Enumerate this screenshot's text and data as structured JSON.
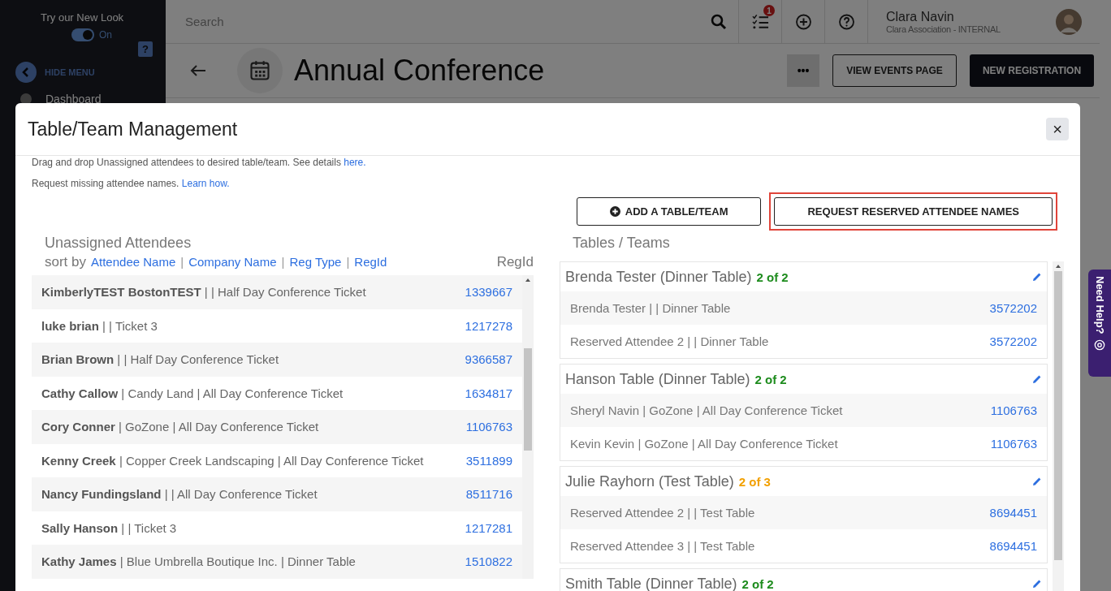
{
  "sidebar": {
    "new_look_label": "Try our New Look",
    "toggle": {
      "on": true,
      "label": "On"
    },
    "help_badge": "?",
    "hide_menu": "HIDE MENU",
    "items": [
      "Dashboard"
    ]
  },
  "top_bar": {
    "search": {
      "placeholder": "Search"
    },
    "tasks_badge": "1",
    "user": {
      "name": "Clara Navin",
      "org": "Clara Association - INTERNAL"
    }
  },
  "page_header": {
    "title": "Annual Conference",
    "more_button": "•••",
    "buttons": [
      "VIEW EVENTS PAGE",
      "NEW REGISTRATION"
    ]
  },
  "modal": {
    "title": "Table/Team Management",
    "close": "×",
    "info": [
      {
        "text": "Drag and drop Unassigned attendees to desired table/team. See details ",
        "link": "here."
      },
      {
        "text": "Request missing attendee names. ",
        "link": "Learn how."
      }
    ],
    "buttons": [
      {
        "label": "ADD A TABLE/TEAM",
        "kind": "add",
        "highlighted": false
      },
      {
        "label": "REQUEST RESERVED ATTENDEE NAMES",
        "kind": "plain",
        "highlighted": true
      }
    ],
    "unassigned": {
      "title": "Unassigned Attendees",
      "sort_label": "sort by",
      "separator": "|",
      "sort_options": [
        "Attendee Name",
        "Company Name",
        "Reg Type",
        "RegId"
      ],
      "regid_header": "RegId",
      "rows": [
        {
          "name": "KimberlyTEST BostonTEST",
          "details": "| | Half Day Conference Ticket",
          "regid": "1339667"
        },
        {
          "name": "luke brian",
          "details": "| | Ticket 3",
          "regid": "1217278"
        },
        {
          "name": "Brian Brown",
          "details": "| | Half Day Conference Ticket",
          "regid": "9366587"
        },
        {
          "name": "Cathy Callow",
          "details": "| Candy Land | All Day Conference Ticket",
          "regid": "1634817"
        },
        {
          "name": "Cory Conner",
          "details": "| GoZone | All Day Conference Ticket",
          "regid": "1106763"
        },
        {
          "name": "Kenny Creek",
          "details": "| Copper Creek Landscaping | All Day Conference Ticket",
          "regid": "3511899"
        },
        {
          "name": "Nancy Fundingsland",
          "details": "| | All Day Conference Ticket",
          "regid": "8511716"
        },
        {
          "name": "Sally Hanson",
          "details": "| | Ticket 3",
          "regid": "1217281"
        },
        {
          "name": "Kathy James",
          "details": "| Blue Umbrella Boutique Inc. | Dinner Table",
          "regid": "1510822"
        }
      ]
    },
    "tables": {
      "title": "Tables / Teams",
      "groups": [
        {
          "name": "Brenda Tester (Dinner Table)",
          "count": "2 of 2",
          "color": "#1e8c1e",
          "members": [
            {
              "text": "Brenda Tester | | Dinner Table",
              "regid": "3572202"
            },
            {
              "text": "Reserved Attendee 2 | | Dinner Table",
              "regid": "3572202"
            }
          ]
        },
        {
          "name": "Hanson Table (Dinner Table)",
          "count": "2 of 2",
          "color": "#1e8c1e",
          "members": [
            {
              "text": "Sheryl Navin | GoZone | All Day Conference Ticket",
              "regid": "1106763"
            },
            {
              "text": "Kevin Kevin | GoZone | All Day Conference Ticket",
              "regid": "1106763"
            }
          ]
        },
        {
          "name": "Julie Rayhorn (Test Table)",
          "count": "2 of 3",
          "color": "#f2a000",
          "members": [
            {
              "text": "Reserved Attendee 2 | | Test Table",
              "regid": "8694451"
            },
            {
              "text": "Reserved Attendee 3 | | Test Table",
              "regid": "8694451"
            }
          ]
        },
        {
          "name": "Smith Table (Dinner Table)",
          "count": "2 of 2",
          "color": "#1e8c1e"
        }
      ]
    }
  },
  "help_tab": "Need Help?"
}
